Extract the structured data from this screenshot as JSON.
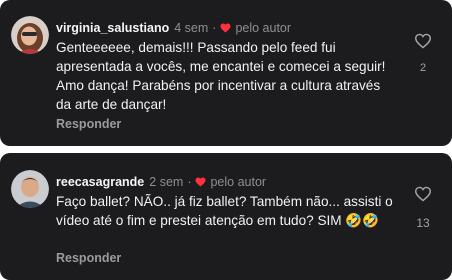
{
  "comments": [
    {
      "username": "virginia_salustiano",
      "time": "4 sem",
      "separator": "·",
      "author_label": "pelo autor",
      "text": "Genteeeeee, demais!!! Passando pelo feed fui apresentada a vocês, me encantei e comecei a seguir! Amo dança! Parabéns por incentivar a cultura através da arte de dançar!",
      "reply_label": "Responder",
      "like_count": "2",
      "avatar_icon": "avatar-photo"
    },
    {
      "username": "reecasagrande",
      "time": "2 sem",
      "separator": "·",
      "author_label": "pelo autor",
      "text": "Faço ballet? NÃO.. já fiz ballet? Também não... assisti o vídeo até o fim e prestei atenção em tudo? SIM",
      "emoji": "🤣🤣",
      "reply_label": "Responder",
      "like_count": "13",
      "avatar_icon": "avatar-photo"
    }
  ],
  "colors": {
    "card_bg": "#1c1c1e",
    "author_heart": "#ff3040",
    "muted_text": "#8e8e93",
    "primary_text": "#f2f2f2"
  },
  "icons": {
    "author_heart": "heart-filled-icon",
    "like": "heart-outline-icon"
  }
}
